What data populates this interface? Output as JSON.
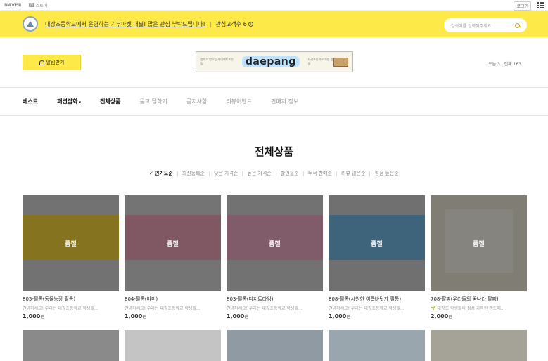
{
  "topbar": {
    "naver": "NAVER",
    "store_badge": "N",
    "store": "스토어",
    "login": "로그인"
  },
  "banner": {
    "text": "대강초등학교에서 운영하는 기부마켓 대필! 많은 관심 부탁드립니다!",
    "separator": "|",
    "interest": "관심고객수 6",
    "search_placeholder": "검색어를 입력해주세요"
  },
  "header": {
    "alarm_label": "알림받기",
    "ad": {
      "left_text": "랩의가 만드는 다이렉트프린팅",
      "brand": "daepang",
      "right_text": "대강초등학교 가방 만들",
      "tagline": "가방"
    },
    "visits": "오늘 3 · 전체 163"
  },
  "nav": [
    {
      "label": "베스트",
      "bold": true
    },
    {
      "label": "패션잡화",
      "bold": true,
      "chevron": "▾"
    },
    {
      "label": "전체상품",
      "bold": true
    },
    {
      "label": "묻고 답하기",
      "bold": false
    },
    {
      "label": "공지사항",
      "bold": false
    },
    {
      "label": "리뷰이벤트",
      "bold": false
    },
    {
      "label": "판매자 정보",
      "bold": false
    }
  ],
  "page_title": "전체상품",
  "sorts": [
    "인기도순",
    "최신등록순",
    "낮은 가격순",
    "높은 가격순",
    "할인율순",
    "누적 판매순",
    "리뷰 많은순",
    "평점 높은순"
  ],
  "sold_out": "품절",
  "products": [
    {
      "name": "805-필통(동물농장 필통)",
      "desc": "안녕하세요! 우리는 대강초등학교 학생들...",
      "price": "1,000",
      "unit": "원",
      "bg": "#f4d23a",
      "strip": "#fff3c4"
    },
    {
      "name": "804-필통(야미)",
      "desc": "안녕하세요! 우리는 대강초등학교 학생들...",
      "price": "1,000",
      "unit": "원",
      "bg": "#e8a0b4",
      "strip": "#fbe2ea"
    },
    {
      "name": "803-필통(디저트타임)",
      "desc": "안녕하세요! 우리는 대강초등학교 학생들...",
      "price": "1,000",
      "unit": "원",
      "bg": "#e9a7c1",
      "strip": "#fde6ef"
    },
    {
      "name": "808-필통(시원한 여름바닷가 필통)",
      "desc": "안녕하세요! 우리는 대강초등학교 학생들...",
      "price": "1,000",
      "unit": "원",
      "bg": "#6fb6e0",
      "strip": "#d6ecf8"
    },
    {
      "name": "708-팔찌(우리들의 꿈나라 팔찌)",
      "desc": "대강초 학생들의 정성 가득한 핸드메...",
      "price": "2,000",
      "unit": "원",
      "bg": "#e9e4d6",
      "strip": "#f5f1e6",
      "leaf": "🌱"
    }
  ]
}
